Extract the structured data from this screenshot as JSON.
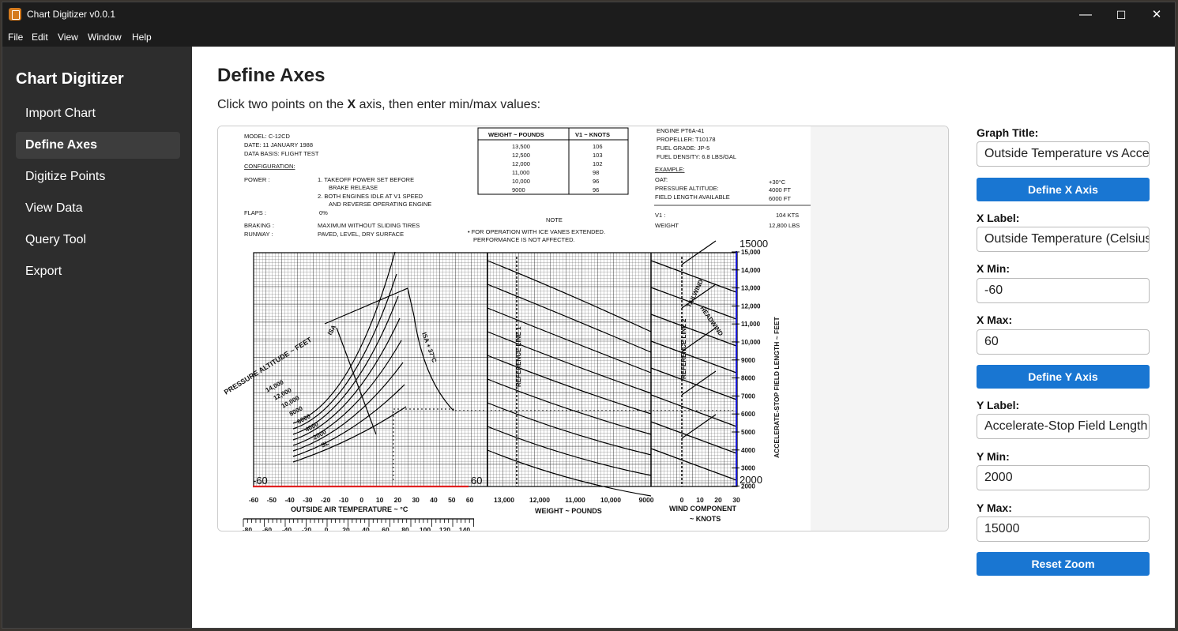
{
  "window": {
    "title": "Chart Digitizer v0.0.1",
    "controls": {
      "minimize": "—",
      "maximize": "☐",
      "close": "✕"
    }
  },
  "menu": [
    "File",
    "Edit",
    "View",
    "Window",
    "Help"
  ],
  "sidebar": {
    "title": "Chart Digitizer",
    "items": [
      {
        "label": "Import Chart",
        "active": false
      },
      {
        "label": "Define Axes",
        "active": true
      },
      {
        "label": "Digitize Points",
        "active": false
      },
      {
        "label": "View Data",
        "active": false
      },
      {
        "label": "Query Tool",
        "active": false
      },
      {
        "label": "Export",
        "active": false
      }
    ]
  },
  "main": {
    "title": "Define Axes",
    "instruction_prefix": "Click two points on the ",
    "instruction_axis": "X",
    "instruction_suffix": " axis, then enter min/max values:"
  },
  "chart": {
    "header": {
      "model": "MODEL: C-12CD",
      "date": "DATE: 11 JANUARY 1988",
      "data_basis": "DATA BASIS: FLIGHT TEST",
      "configuration": "CONFIGURATION:",
      "power_label": "POWER :",
      "power_1a": "1. TAKEOFF POWER SET BEFORE",
      "power_1b": "BRAKE RELEASE",
      "power_2a": "2. BOTH ENGINES IDLE AT V1 SPEED",
      "power_2b": "AND REVERSE OPERATING ENGINE",
      "flaps_label": "FLAPS :",
      "flaps_val": "0%",
      "braking_label": "BRAKING :",
      "braking_val": "MAXIMUM WITHOUT SLIDING TIRES",
      "runway_label": "RUNWAY :",
      "runway_val": "PAVED, LEVEL, DRY SURFACE",
      "note_title": "NOTE",
      "note_1": "• FOR OPERATION WITH ICE VANES EXTENDED.",
      "note_2": "PERFORMANCE IS NOT AFFECTED.",
      "engine": "ENGINE PT6A-41",
      "propeller": "PROPELLER: T10178",
      "fuel_grade": "FUEL GRADE: JP-5",
      "fuel_density": "FUEL DENSITY: 6.8 LBS/GAL",
      "example": "EXAMPLE:",
      "oat_label": "OAT:",
      "oat_val": "+30°C",
      "pa_label": "PRESSURE ALTITUDE:",
      "pa_val": "4000 FT",
      "fla_label": "FIELD LENGTH AVAILABLE",
      "fla_val": "6000 FT",
      "v1_label": "V1 :",
      "v1_val": "104 KTS",
      "weight_label": "WEIGHT",
      "weight_val": "12,800 LBS"
    },
    "table": {
      "col1": "WEIGHT ~ POUNDS",
      "col2": "V1 ~ KNOTS",
      "rows": [
        [
          "13,500",
          "106"
        ],
        [
          "12,500",
          "103"
        ],
        [
          "12,000",
          "102"
        ],
        [
          "11,000",
          "98"
        ],
        [
          "10,000",
          "96"
        ],
        [
          "9000",
          "96"
        ]
      ]
    },
    "labels": {
      "pressure_altitude": "PRESSURE ALTITUDE ~ FEET",
      "isa": "ISA",
      "isa_plus": "ISA + 37°C",
      "ref_line_1": "REFERENCE LINE 1",
      "ref_line_2": "REFERENCE LINE 2",
      "tailwind": "TAILWIND",
      "headwind": "HEADWIND",
      "y_axis_title": "ACCELERATE-STOP FIELD LENGTH ~ FEET",
      "x_axis_1": "OUTSIDE AIR TEMPERATURE ~ °C",
      "x_axis_2": "WEIGHT ~ POUNDS",
      "x_axis_3a": "WIND COMPONENT",
      "x_axis_3b": "~ KNOTS",
      "calib_xmin": "-60",
      "calib_xmax": "60",
      "calib_ymax": "15000",
      "calib_ymin": "2000"
    },
    "altitude_labels": [
      "14,000",
      "12,000",
      "10,000",
      "8000",
      "6000",
      "4000",
      "2000",
      "SL"
    ],
    "y_ticks": [
      "15,000",
      "14,000",
      "13,000",
      "12,000",
      "11,000",
      "10,000",
      "9000",
      "8000",
      "7000",
      "6000",
      "5000",
      "4000",
      "3000",
      "2000"
    ],
    "x_ticks_temp": [
      "-60",
      "-50",
      "-40",
      "-30",
      "-20",
      "-10",
      "0",
      "10",
      "20",
      "30",
      "40",
      "50",
      "60"
    ],
    "x_ticks_f": [
      "-80",
      "-60",
      "-40",
      "-20",
      "0",
      "20",
      "40",
      "60",
      "80",
      "100",
      "120",
      "140"
    ],
    "x_ticks_weight": [
      "13,000",
      "12,000",
      "11,000",
      "10,000",
      "9000"
    ],
    "x_ticks_wind": [
      "0",
      "10",
      "20",
      "30"
    ]
  },
  "panel": {
    "graph_title_label": "Graph Title:",
    "graph_title_value": "Outside Temperature vs Accelerate-Stop",
    "define_x_btn": "Define X Axis",
    "x_label_label": "X Label:",
    "x_label_value": "Outside Temperature (Celsius)",
    "x_min_label": "X Min:",
    "x_min_value": "-60",
    "x_max_label": "X Max:",
    "x_max_value": "60",
    "define_y_btn": "Define Y Axis",
    "y_label_label": "Y Label:",
    "y_label_value": "Accelerate-Stop Field Length (feet)",
    "y_min_label": "Y Min:",
    "y_min_value": "2000",
    "y_max_label": "Y Max:",
    "y_max_value": "15000",
    "reset_btn": "Reset Zoom",
    "accent_color": "#1976d2"
  }
}
